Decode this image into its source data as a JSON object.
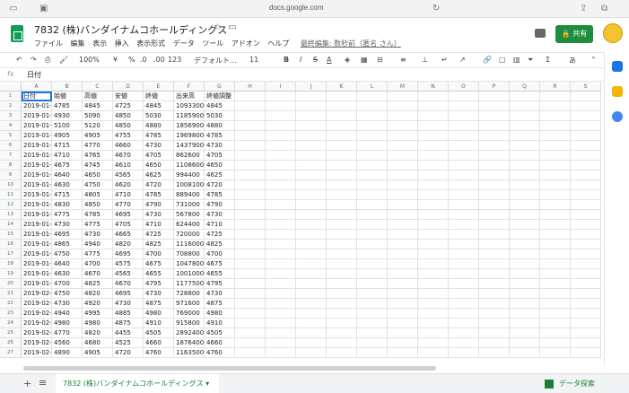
{
  "browser": {
    "url": "docs.google.com"
  },
  "header": {
    "title": "7832 (株)バンダイナムコホールディングス",
    "menus": [
      "ファイル",
      "編集",
      "表示",
      "挿入",
      "表示形式",
      "データ",
      "ツール",
      "アドオン",
      "ヘルプ"
    ],
    "last_edit": "最終編集: 数秒前（匿名 さん）",
    "share_label": "共有"
  },
  "toolbar": {
    "zoom": "100%",
    "currency": "¥",
    "percent": "%",
    "decimal_dec": ".0",
    "decimal_inc": ".00",
    "number_format": "123",
    "font": "デフォルト...",
    "font_size": "11",
    "bold": "B",
    "italic": "I",
    "strike": "S",
    "text_color": "A"
  },
  "formula_bar": {
    "fx": "fx",
    "content": "日付"
  },
  "columns": [
    "A",
    "B",
    "C",
    "D",
    "E",
    "F",
    "G",
    "H",
    "I",
    "J",
    "K",
    "L",
    "M",
    "N",
    "O",
    "P",
    "Q",
    "R",
    "S"
  ],
  "rows": [
    [
      "日付",
      "始値",
      "高値",
      "安値",
      "終値",
      "出来高",
      "終値調整"
    ],
    [
      "2019-01-0",
      "4785",
      "4845",
      "4725",
      "4845",
      "1093300",
      "4845"
    ],
    [
      "2019-01-0",
      "4930",
      "5090",
      "4850",
      "5030",
      "1185900",
      "5030"
    ],
    [
      "2019-01-0",
      "5100",
      "5120",
      "4850",
      "4880",
      "1856900",
      "4880"
    ],
    [
      "2019-01-0",
      "4905",
      "4905",
      "4755",
      "4785",
      "1969800",
      "4785"
    ],
    [
      "2019-01-1",
      "4715",
      "4770",
      "4660",
      "4730",
      "1437900",
      "4730"
    ],
    [
      "2019-01-1",
      "4710",
      "4765",
      "4670",
      "4705",
      "862600",
      "4705"
    ],
    [
      "2019-01-1",
      "4675",
      "4745",
      "4610",
      "4650",
      "1108600",
      "4650"
    ],
    [
      "2019-01-1",
      "4640",
      "4650",
      "4565",
      "4625",
      "994400",
      "4625"
    ],
    [
      "2019-01-1",
      "4630",
      "4750",
      "4620",
      "4720",
      "1008100",
      "4720"
    ],
    [
      "2019-01-1",
      "4715",
      "4805",
      "4710",
      "4785",
      "889400",
      "4785"
    ],
    [
      "2019-01-2",
      "4830",
      "4850",
      "4770",
      "4790",
      "731000",
      "4790"
    ],
    [
      "2019-01-2",
      "4775",
      "4785",
      "4695",
      "4730",
      "567800",
      "4730"
    ],
    [
      "2019-01-2",
      "4730",
      "4775",
      "4705",
      "4710",
      "624400",
      "4710"
    ],
    [
      "2019-01-2",
      "4695",
      "4730",
      "4665",
      "4725",
      "720000",
      "4725"
    ],
    [
      "2019-01-2",
      "4865",
      "4940",
      "4820",
      "4825",
      "1116000",
      "4825"
    ],
    [
      "2019-01-2",
      "4750",
      "4775",
      "4695",
      "4700",
      "708800",
      "4700"
    ],
    [
      "2019-01-2",
      "4640",
      "4700",
      "4575",
      "4675",
      "1047800",
      "4675"
    ],
    [
      "2019-01-3",
      "4630",
      "4670",
      "4565",
      "4655",
      "1001000",
      "4655"
    ],
    [
      "2019-01-3",
      "4700",
      "4825",
      "4670",
      "4795",
      "1177500",
      "4795"
    ],
    [
      "2019-02-0",
      "4750",
      "4820",
      "4695",
      "4730",
      "728800",
      "4730"
    ],
    [
      "2019-02-0",
      "4730",
      "4920",
      "4730",
      "4875",
      "971600",
      "4875"
    ],
    [
      "2019-02-0",
      "4940",
      "4995",
      "4885",
      "4980",
      "769000",
      "4980"
    ],
    [
      "2019-02-0",
      "4980",
      "4980",
      "4875",
      "4910",
      "915800",
      "4910"
    ],
    [
      "2019-02-0",
      "4770",
      "4820",
      "4455",
      "4505",
      "2892400",
      "4505"
    ],
    [
      "2019-02-0",
      "4560",
      "4680",
      "4525",
      "4660",
      "1876400",
      "4660"
    ],
    [
      "2019-02-1",
      "4890",
      "4905",
      "4720",
      "4760",
      "1163500",
      "4760"
    ]
  ],
  "bottom": {
    "add": "+",
    "menu": "≡",
    "sheet_tab": "7832 (株)バンダイナムコホールディングス",
    "explore": "データ探索"
  },
  "colors": {
    "accent": "#1a73e8",
    "brand": "#0f9d58",
    "share": "#1e8e3e"
  }
}
